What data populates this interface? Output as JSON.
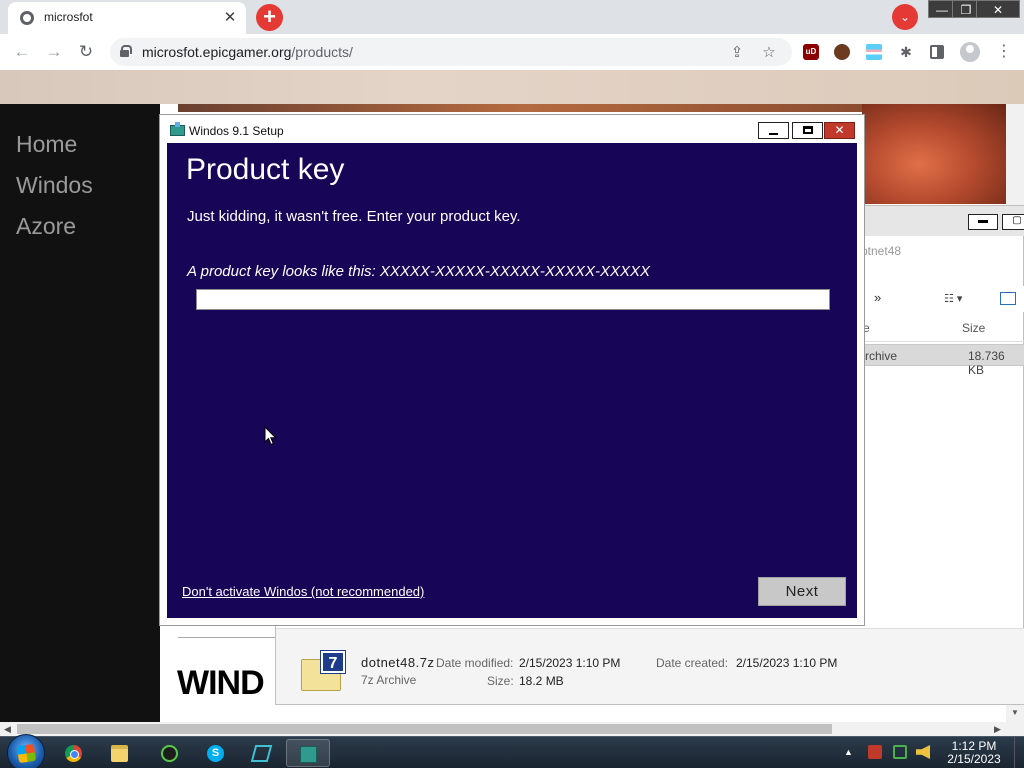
{
  "browser": {
    "tab_title": "microsfot",
    "tab_close": "✕",
    "new_tab": "+",
    "tab_search": "⌄",
    "window_controls": {
      "minimize": "—",
      "restore": "❐",
      "close": "✕"
    },
    "nav": {
      "back": "←",
      "forward": "→",
      "reload": "↻"
    },
    "url_domain": "microsfot.epicgamer.org",
    "url_path": "/products/",
    "share_icon": "⇪",
    "bookmark_icon": "☆",
    "ext_ublock": "uD",
    "puzzle_icon": "✱",
    "menu_icon": "⋮"
  },
  "site": {
    "nav_items": [
      {
        "label": "Home"
      },
      {
        "label": "Windos"
      },
      {
        "label": "Azore"
      }
    ],
    "heading_partial": "WIND"
  },
  "explorer": {
    "min_glyph": "▬",
    "max_glyph": "▢",
    "address_partial": "otnet48",
    "chevron": "»",
    "view_glyph": "☷ ▾",
    "col_type_partial": "e",
    "col_size": "Size",
    "row_type_partial": "rchive",
    "row_size": "18.736 KB",
    "details": {
      "name": "dotnet48.7z",
      "type": "7z Archive",
      "date_modified_label": "Date modified:",
      "date_modified": "2/15/2023 1:10 PM",
      "date_created_label": "Date created:",
      "date_created": "2/15/2023 1:10 PM",
      "size_label": "Size:",
      "size": "18.2 MB",
      "icon_label": "7"
    }
  },
  "dialog": {
    "title": "Windos 9.1 Setup",
    "close_glyph": "✕",
    "heading": "Product key",
    "subtitle": "Just kidding, it wasn't free. Enter your product key.",
    "hint": "A product key looks like this: XXXXX-XXXXX-XXXXX-XXXXX-XXXXX",
    "key_value": "",
    "skip_link": "Don't activate Windos (not recommended)",
    "next_label": "Next"
  },
  "taskbar": {
    "time": "1:12 PM",
    "date": "2/15/2023",
    "skype_letter": "S",
    "tray_up": "▲"
  },
  "colors": {
    "dialog_body": "#170557",
    "dialog_close": "#c0392b",
    "browser_accent": "#e53935"
  }
}
